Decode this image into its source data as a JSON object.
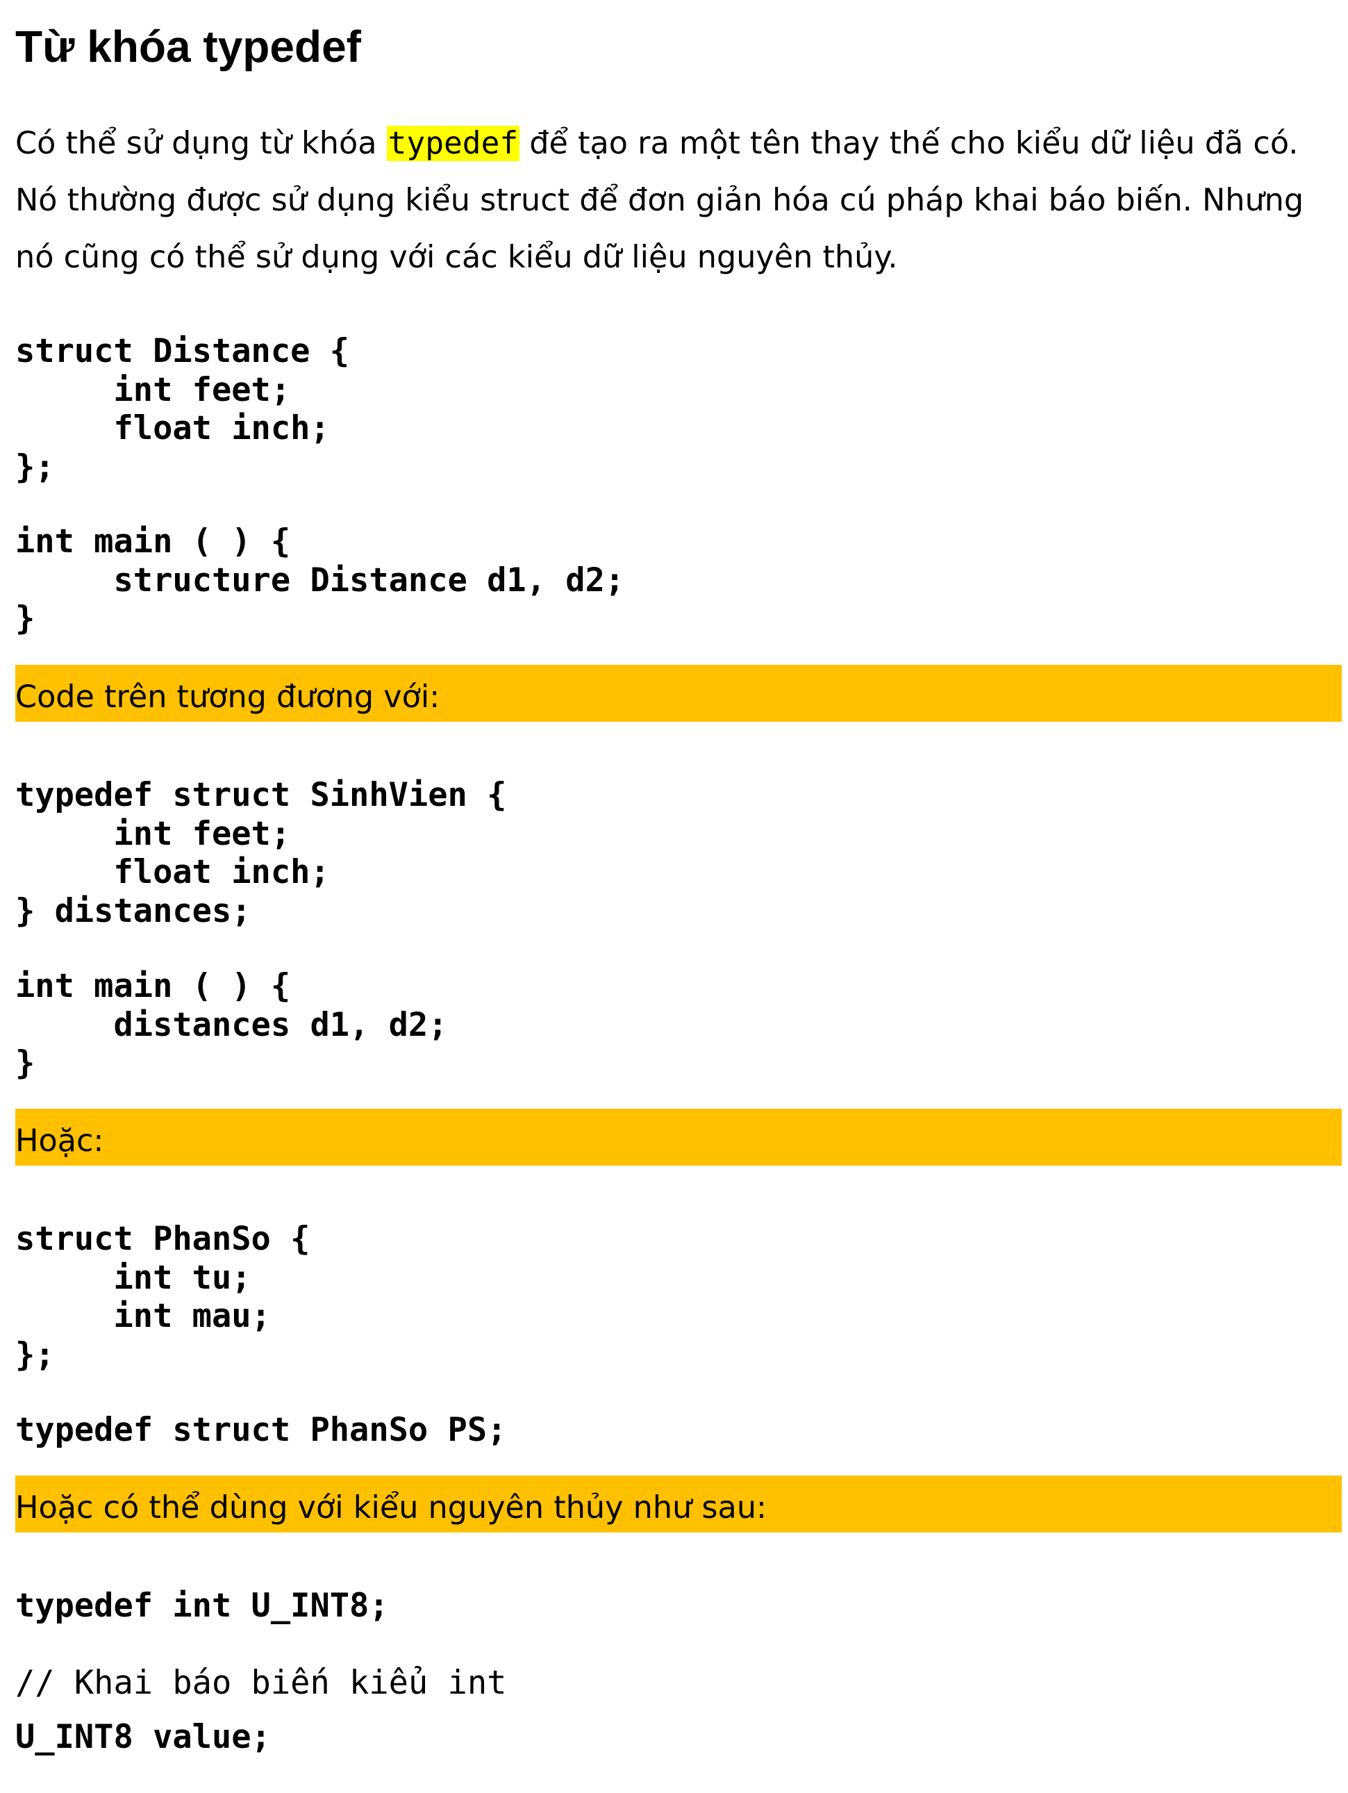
{
  "title": "Từ khóa typedef",
  "intro": {
    "before": "Có thể sử dụng từ khóa ",
    "keyword": "typedef",
    "after": " để tạo ra một tên thay thế cho kiểu dữ liệu đã có. Nó thường được sử dụng kiểu struct để đơn giản hóa cú pháp khai báo biến. Nhưng nó cũng có thể sử dụng với các kiểu dữ liệu nguyên thủy."
  },
  "code1": "struct Distance {\n     int feet;\n     float inch;\n};",
  "code2": "int main ( ) {\n     structure Distance d1, d2;\n}",
  "note1": "Code trên tương đương với:",
  "code3": "typedef struct SinhVien {\n     int feet;\n     float inch;\n} distances;",
  "code4": "int main ( ) {\n     distances d1, d2;\n}",
  "note2": "Hoặc:",
  "code5": "struct PhanSo {\n     int tu;\n     int mau;\n};",
  "code6": "typedef struct PhanSo PS;",
  "note3": "Hoặc có thể dùng với kiểu nguyên thủy như sau:",
  "code7": "typedef int U_INT8;",
  "comment": "// Khai báo biêń kiêủ int",
  "code8": "U_INT8 value;"
}
